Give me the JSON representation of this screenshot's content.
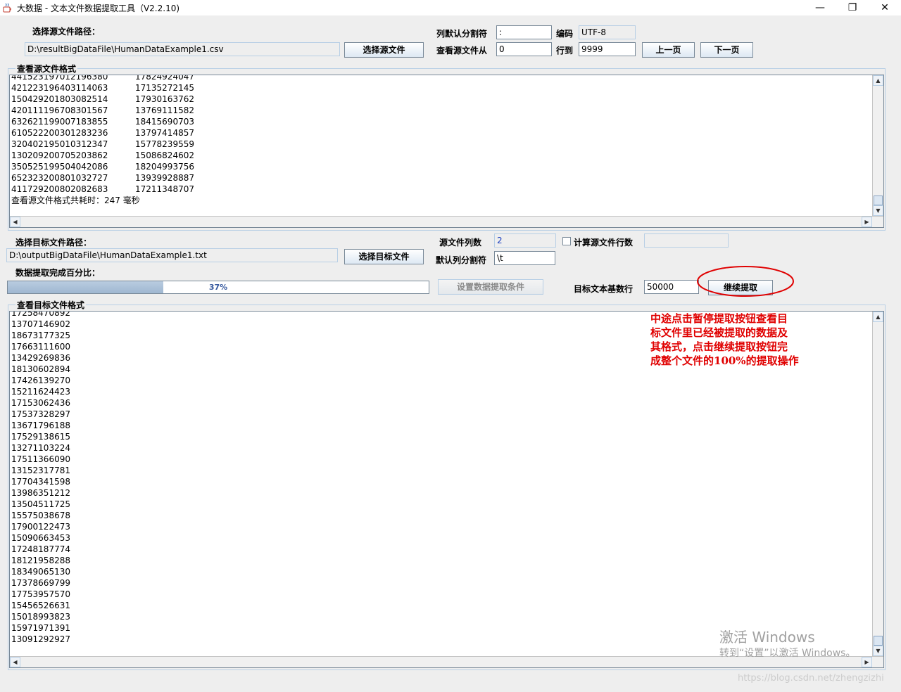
{
  "window": {
    "title": "大数据 - 文本文件数据提取工具（V2.2.10)",
    "icon": "java-coffee-icon",
    "minimize_glyph": "—",
    "restore_glyph": "❐",
    "close_glyph": "✕"
  },
  "source": {
    "path_label": "选择源文件路径：",
    "path_value": "D:\\resultBigDataFile\\HumanDataExample1.csv",
    "choose_button": "选择源文件",
    "delimiter_label": "列默认分割符",
    "delimiter_value": ":",
    "encoding_label": "编码",
    "encoding_value": "UTF-8",
    "view_from_label": "查看源文件从",
    "view_from_value": "0",
    "to_line_label": "行到",
    "to_line_value": "9999",
    "prev_button": "上一页",
    "next_button": "下一页"
  },
  "source_view": {
    "title": "查看源文件格式",
    "partial_top": [
      "441523197012196380",
      "17824924047"
    ],
    "rows": [
      [
        "421223196403114063",
        "17135272145"
      ],
      [
        "150429201803082514",
        "17930163762"
      ],
      [
        "420111196708301567",
        "13769111582"
      ],
      [
        "632621199007183855",
        "18415690703"
      ],
      [
        "610522200301283236",
        "13797414857"
      ],
      [
        "320402195010312347",
        "15778239559"
      ],
      [
        "130209200705203862",
        "15086824602"
      ],
      [
        "350525199504042086",
        "18204993756"
      ],
      [
        "652323200801032727",
        "13939928887"
      ],
      [
        "411729200802082683",
        "17211348707"
      ]
    ],
    "timing": "查看源文件格式共耗时：247 毫秒"
  },
  "target": {
    "path_label": "选择目标文件路径：",
    "path_value": "D:\\outputBigDataFile\\HumanDataExample1.txt",
    "choose_button": "选择目标文件",
    "col_count_label": "源文件列数",
    "col_count_value": "2",
    "count_rows_label": "计算源文件行数",
    "count_rows_checked": false,
    "count_rows_value": "",
    "default_delim_label": "默认列分割符",
    "default_delim_value": "\\t",
    "progress_label": "数据提取完成百分比：",
    "progress_percent": 37,
    "progress_text": "37%",
    "set_conditions_button": "设置数据提取条件",
    "base_rows_label": "目标文本基数行",
    "base_rows_value": "50000",
    "continue_button": "继续提取"
  },
  "target_view": {
    "title": "查看目标文件格式",
    "partial_top": "17258470892",
    "rows": [
      "13707146902",
      "18673177325",
      "17663111600",
      "13429269836",
      "18130602894",
      "17426139270",
      "15211624423",
      "17153062436",
      "17537328297",
      "13671796188",
      "17529138615",
      "13271103224",
      "17511366090",
      "13152317781",
      "17704341598",
      "13986351212",
      "13504511725",
      "15575038678",
      "17900122473",
      "15090663453",
      "17248187774",
      "18121958288",
      "18349065130",
      "17378669799",
      "17753957570",
      "15456526631",
      "15018993823",
      "15971971391",
      "13091292927"
    ]
  },
  "annotation": {
    "lines": [
      "中途点击暂停提取按钮查看目",
      "标文件里已经被提取的数据及",
      "其格式，点击继续提取按钮完",
      "成整个文件的100%的提取操作"
    ],
    "color": "#e00000"
  },
  "watermarks": {
    "activate_title": "激活 Windows",
    "activate_sub": "转到“设置”以激活 Windows。",
    "blog_url": "https://blog.csdn.net/zhengzizhi"
  }
}
